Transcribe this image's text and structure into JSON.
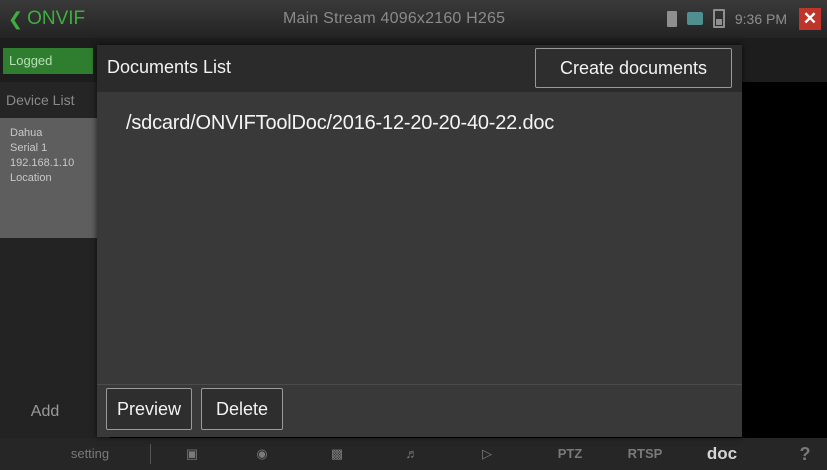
{
  "topbar": {
    "back_icon": "back-arrow-icon",
    "app_title": "ONVIF",
    "stream_title": "Main Stream 4096x2160 H265",
    "time": "9:36 PM",
    "close_icon": "close-icon"
  },
  "background": {
    "logged_label": "Logged",
    "device_list_label": "Device List",
    "device_card": [
      "Dahua",
      "Serial 1",
      "192.168.1.10",
      "Location"
    ],
    "add_label": "Add"
  },
  "bottombar": {
    "setting_label": "setting",
    "ptz_label": "PTZ",
    "rtsp_label": "RTSP",
    "doc_label": "doc",
    "help_label": "?"
  },
  "dialog": {
    "title": "Documents List",
    "create_label": "Create documents",
    "documents": [
      "/sdcard/ONVIFToolDoc/2016-12-20-20-40-22.doc"
    ],
    "preview_label": "Preview",
    "delete_label": "Delete"
  },
  "colors": {
    "accent_green": "#3fae3f",
    "close_red": "#c0352b",
    "dialog_bg": "#393939"
  }
}
